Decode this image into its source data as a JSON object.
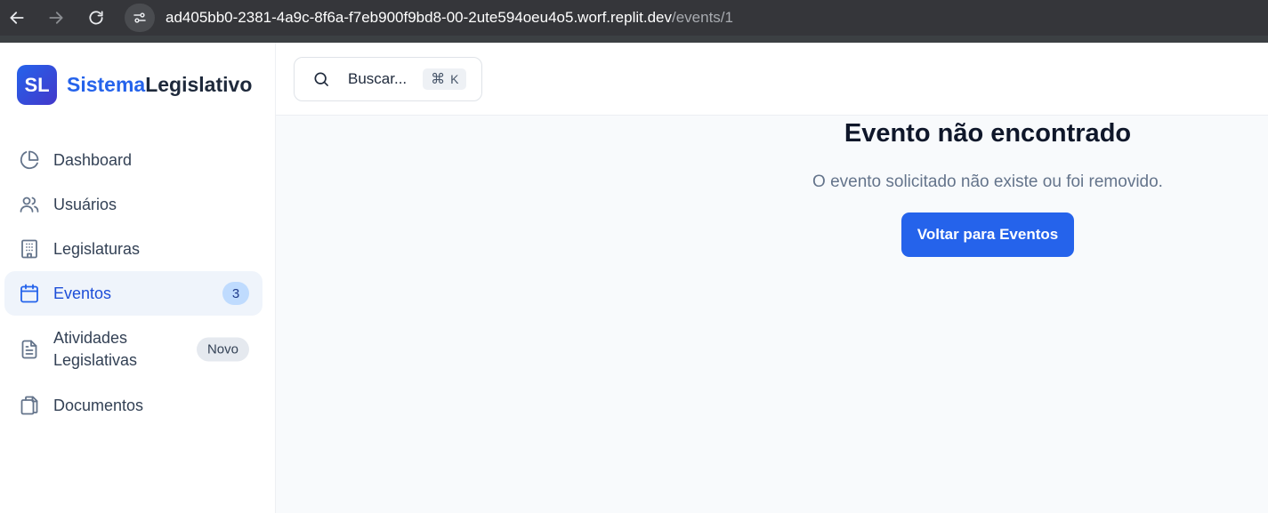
{
  "browser": {
    "url_host": "ad405bb0-2381-4a9c-8f6a-f7eb900f9bd8-00-2ute594oeu4o5.worf.replit.dev",
    "url_path": "/events/1"
  },
  "brand": {
    "logo_text": "SL",
    "name_part1": "Sistema",
    "name_part2": "Legislativo",
    "accent_color": "#2563eb"
  },
  "search": {
    "placeholder": "Buscar...",
    "shortcut_symbol": "⌘",
    "shortcut_key": "K"
  },
  "sidebar": {
    "items": [
      {
        "label": "Dashboard",
        "icon": "pie-chart-icon"
      },
      {
        "label": "Usuários",
        "icon": "users-icon"
      },
      {
        "label": "Legislaturas",
        "icon": "building-icon"
      },
      {
        "label": "Eventos",
        "icon": "calendar-icon",
        "active": true,
        "badge": "3"
      },
      {
        "label": "Atividades Legislativas",
        "icon": "file-text-icon",
        "badge": "Novo"
      },
      {
        "label": "Documentos",
        "icon": "files-icon"
      }
    ]
  },
  "main": {
    "title": "Evento não encontrado",
    "message": "O evento solicitado não existe ou foi removido.",
    "button_label": "Voltar para Eventos",
    "button_color": "#2563eb"
  }
}
